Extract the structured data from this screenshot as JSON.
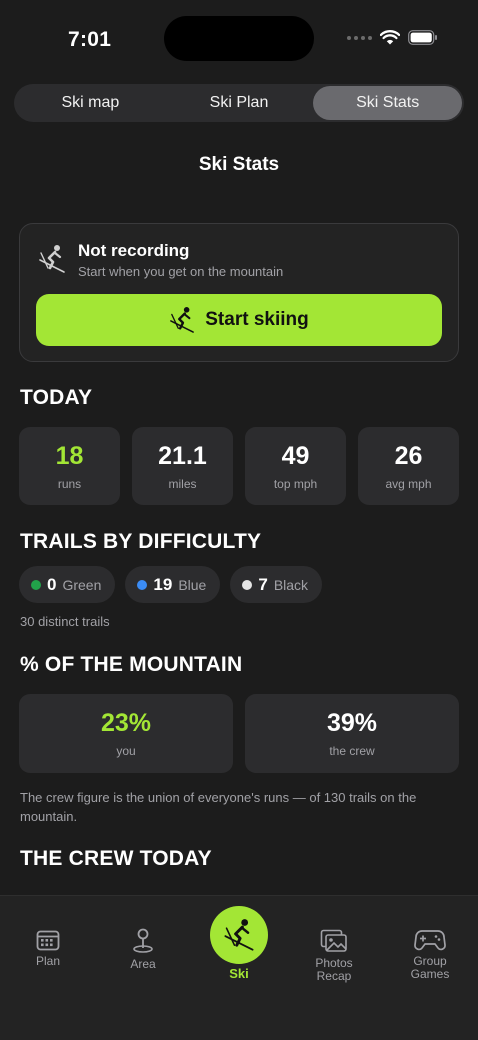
{
  "status_bar": {
    "time": "7:01"
  },
  "segments": [
    {
      "label": "Ski map",
      "active": false
    },
    {
      "label": "Ski Plan",
      "active": false
    },
    {
      "label": "Ski Stats",
      "active": true
    }
  ],
  "page_title": "Ski Stats",
  "recording": {
    "title": "Not recording",
    "subtitle": "Start when you get on the mountain",
    "button_label": "Start skiing"
  },
  "today": {
    "title": "TODAY",
    "stats": [
      {
        "value": "18",
        "label": "runs"
      },
      {
        "value": "21.1",
        "label": "miles"
      },
      {
        "value": "49",
        "label": "top mph"
      },
      {
        "value": "26",
        "label": "avg mph"
      }
    ]
  },
  "trails": {
    "title": "TRAILS BY DIFFICULTY",
    "chips": [
      {
        "count": "0",
        "label": "Green",
        "color": "#22a34a"
      },
      {
        "count": "19",
        "label": "Blue",
        "color": "#3b8cf5"
      },
      {
        "count": "7",
        "label": "Black",
        "color": "#e5e5e5"
      }
    ],
    "distinct": "30 distinct trails"
  },
  "mountain": {
    "title": "% OF THE MOUNTAIN",
    "cards": [
      {
        "value": "23%",
        "label": "you"
      },
      {
        "value": "39%",
        "label": "the crew"
      }
    ],
    "note": "The crew figure is the union of everyone's runs — of 130 trails on the mountain."
  },
  "crew": {
    "title": "THE CREW TODAY"
  },
  "tabs": [
    {
      "label": "Plan",
      "icon": "calendar-icon"
    },
    {
      "label": "Area",
      "icon": "map-pin-icon"
    },
    {
      "label": "Ski",
      "icon": "skier-icon",
      "active": true
    },
    {
      "label": "Photos\nRecap",
      "icon": "photos-icon"
    },
    {
      "label": "Group\nGames",
      "icon": "gamepad-icon"
    }
  ],
  "colors": {
    "accent": "#a3e635",
    "background": "#1c1c1c",
    "card": "#2c2c2e"
  }
}
